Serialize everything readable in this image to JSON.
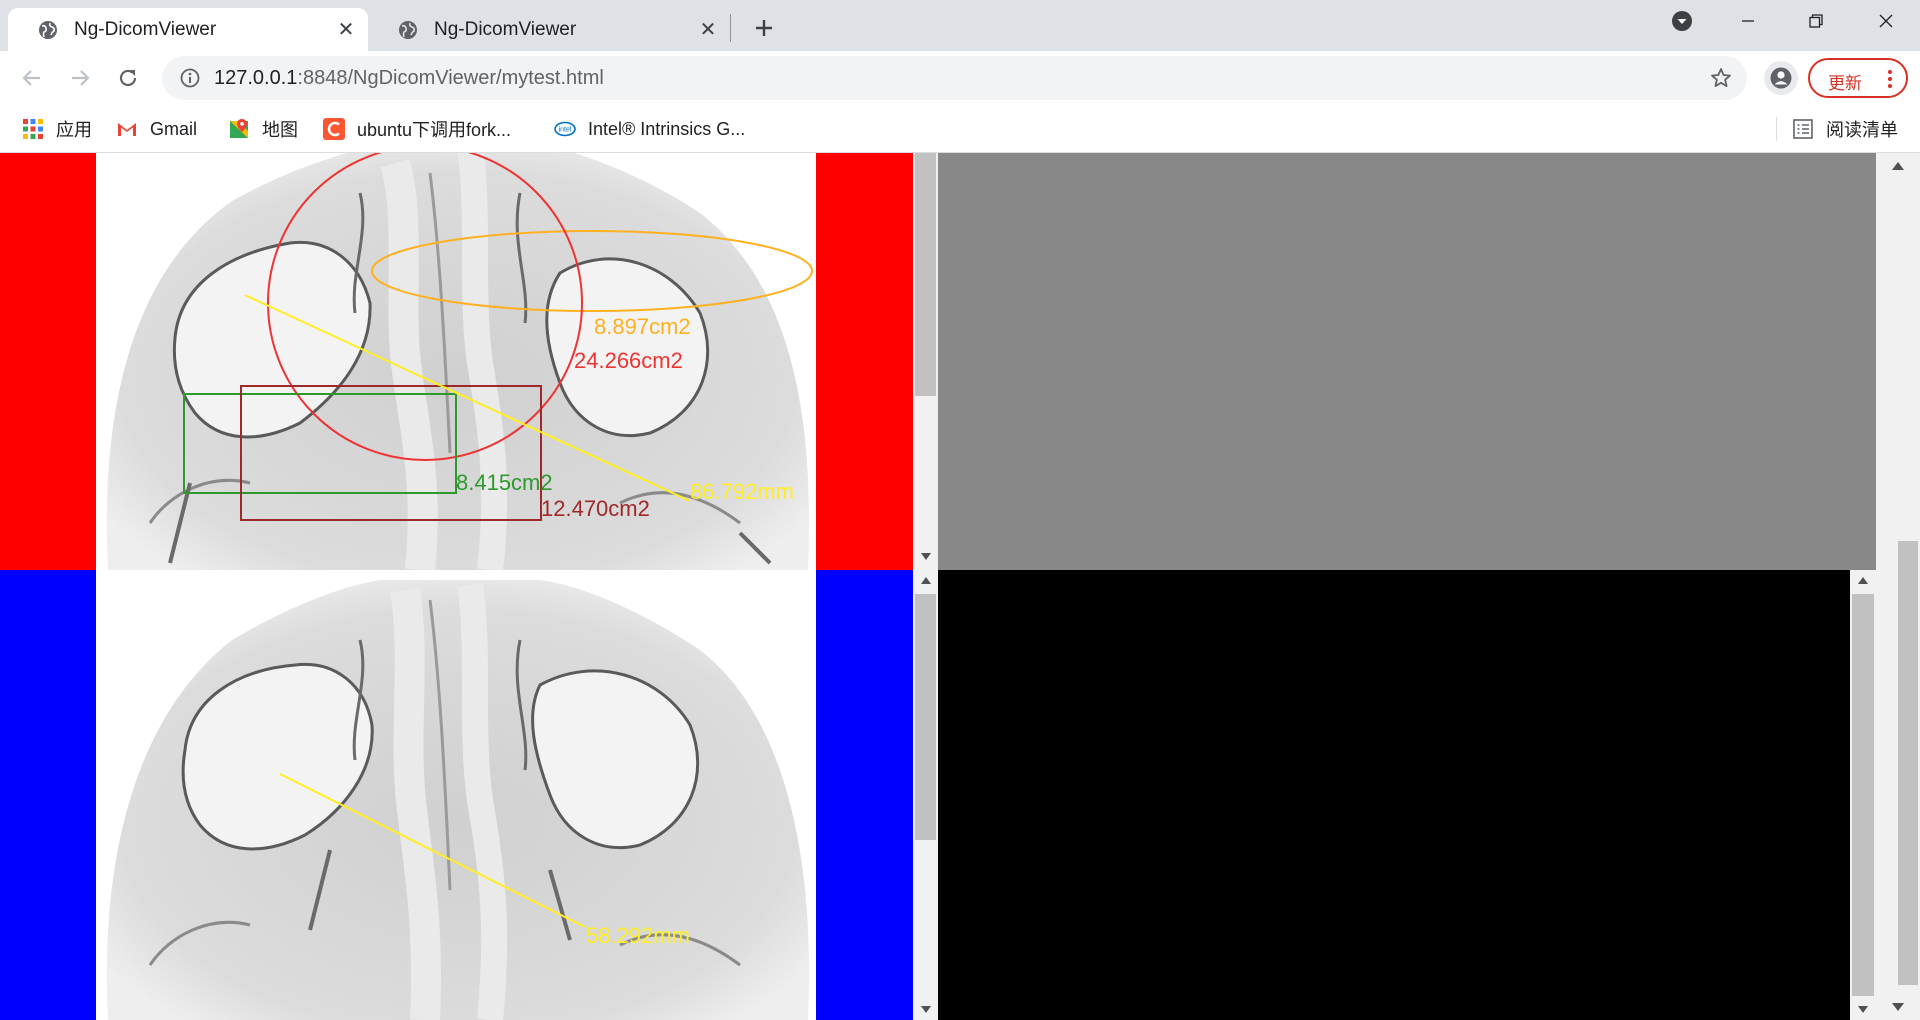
{
  "tabs": [
    {
      "title": "Ng-DicomViewer",
      "active": true
    },
    {
      "title": "Ng-DicomViewer",
      "active": false
    }
  ],
  "toolbar": {
    "url_host": "127.0.0.1",
    "url_rest": ":8848/NgDicomViewer/mytest.html",
    "update_label": "更新"
  },
  "bookmarks": [
    {
      "label": "应用",
      "icon": "apps-grid-icon"
    },
    {
      "label": "Gmail",
      "icon": "gmail-icon"
    },
    {
      "label": "地图",
      "icon": "maps-icon"
    },
    {
      "label": "ubuntu下调用fork...",
      "icon": "csdn-icon"
    },
    {
      "label": "Intel® Intrinsics G...",
      "icon": "intel-icon"
    }
  ],
  "reading_list_label": "阅读清单",
  "viewers": {
    "top_left": {
      "border_color": "#ff0000",
      "measurements": {
        "ellipse_area": "8.897cm2",
        "circle_area": "24.266cm2",
        "green_rect_area": "8.415cm2",
        "red_rect_area": "12.470cm2",
        "line_length": "86.792mm"
      }
    },
    "bottom_left": {
      "border_color": "#0000ff",
      "measurements": {
        "line_length": "58.292mm"
      }
    },
    "top_right": {
      "background": "#888888"
    },
    "bottom_right": {
      "background": "#000000"
    }
  },
  "colors": {
    "ellipse": "#ffb020",
    "circle": "#ee3333",
    "green_rect": "#2e9a2e",
    "red_rect": "#a02828",
    "line": "#ffee22"
  }
}
